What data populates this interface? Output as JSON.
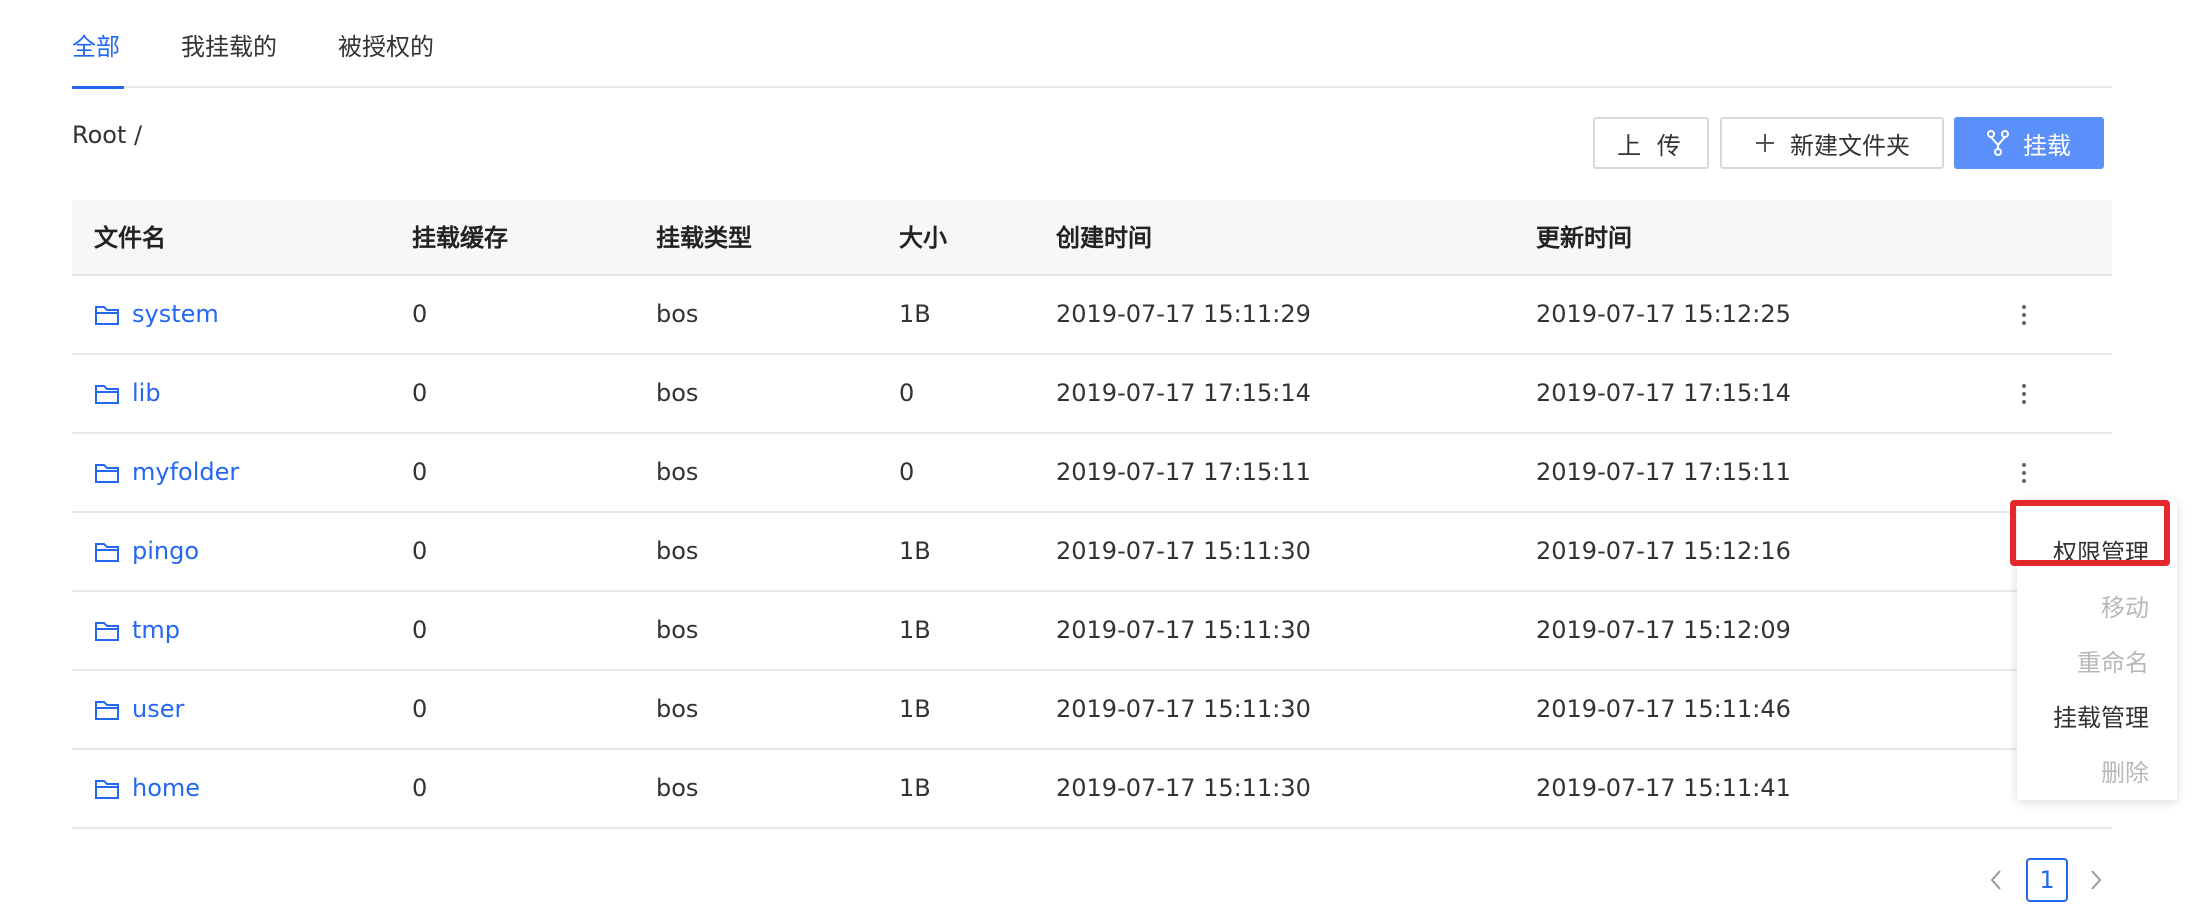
{
  "tabs": [
    {
      "label": "全部",
      "active": true
    },
    {
      "label": "我挂载的",
      "active": false
    },
    {
      "label": "被授权的",
      "active": false
    }
  ],
  "breadcrumb": "Root /",
  "toolbar": {
    "upload_label": "上 传",
    "new_folder_label": "新建文件夹",
    "mount_label": "挂载"
  },
  "table": {
    "headers": [
      "文件名",
      "挂载缓存",
      "挂载类型",
      "大小",
      "创建时间",
      "更新时间"
    ],
    "rows": [
      {
        "name": "system",
        "cache": "0",
        "type": "bos",
        "size": "1B",
        "created": "2019-07-17 15:11:29",
        "updated": "2019-07-17 15:12:25"
      },
      {
        "name": "lib",
        "cache": "0",
        "type": "bos",
        "size": "0",
        "created": "2019-07-17 17:15:14",
        "updated": "2019-07-17 17:15:14"
      },
      {
        "name": "myfolder",
        "cache": "0",
        "type": "bos",
        "size": "0",
        "created": "2019-07-17 17:15:11",
        "updated": "2019-07-17 17:15:11"
      },
      {
        "name": "pingo",
        "cache": "0",
        "type": "bos",
        "size": "1B",
        "created": "2019-07-17 15:11:30",
        "updated": "2019-07-17 15:12:16"
      },
      {
        "name": "tmp",
        "cache": "0",
        "type": "bos",
        "size": "1B",
        "created": "2019-07-17 15:11:30",
        "updated": "2019-07-17 15:12:09"
      },
      {
        "name": "user",
        "cache": "0",
        "type": "bos",
        "size": "1B",
        "created": "2019-07-17 15:11:30",
        "updated": "2019-07-17 15:11:46"
      },
      {
        "name": "home",
        "cache": "0",
        "type": "bos",
        "size": "1B",
        "created": "2019-07-17 15:11:30",
        "updated": "2019-07-17 15:11:41"
      }
    ]
  },
  "context_menu": {
    "items": [
      {
        "label": "权限管理",
        "disabled": false,
        "highlighted": true
      },
      {
        "label": "移动",
        "disabled": true
      },
      {
        "label": "重命名",
        "disabled": true
      },
      {
        "label": "挂载管理",
        "disabled": false
      },
      {
        "label": "删除",
        "disabled": true
      }
    ]
  },
  "pagination": {
    "current_page": "1"
  },
  "colors": {
    "accent": "#2468f2",
    "primary_button": "#5b8ff9",
    "highlight": "#e4262d"
  }
}
